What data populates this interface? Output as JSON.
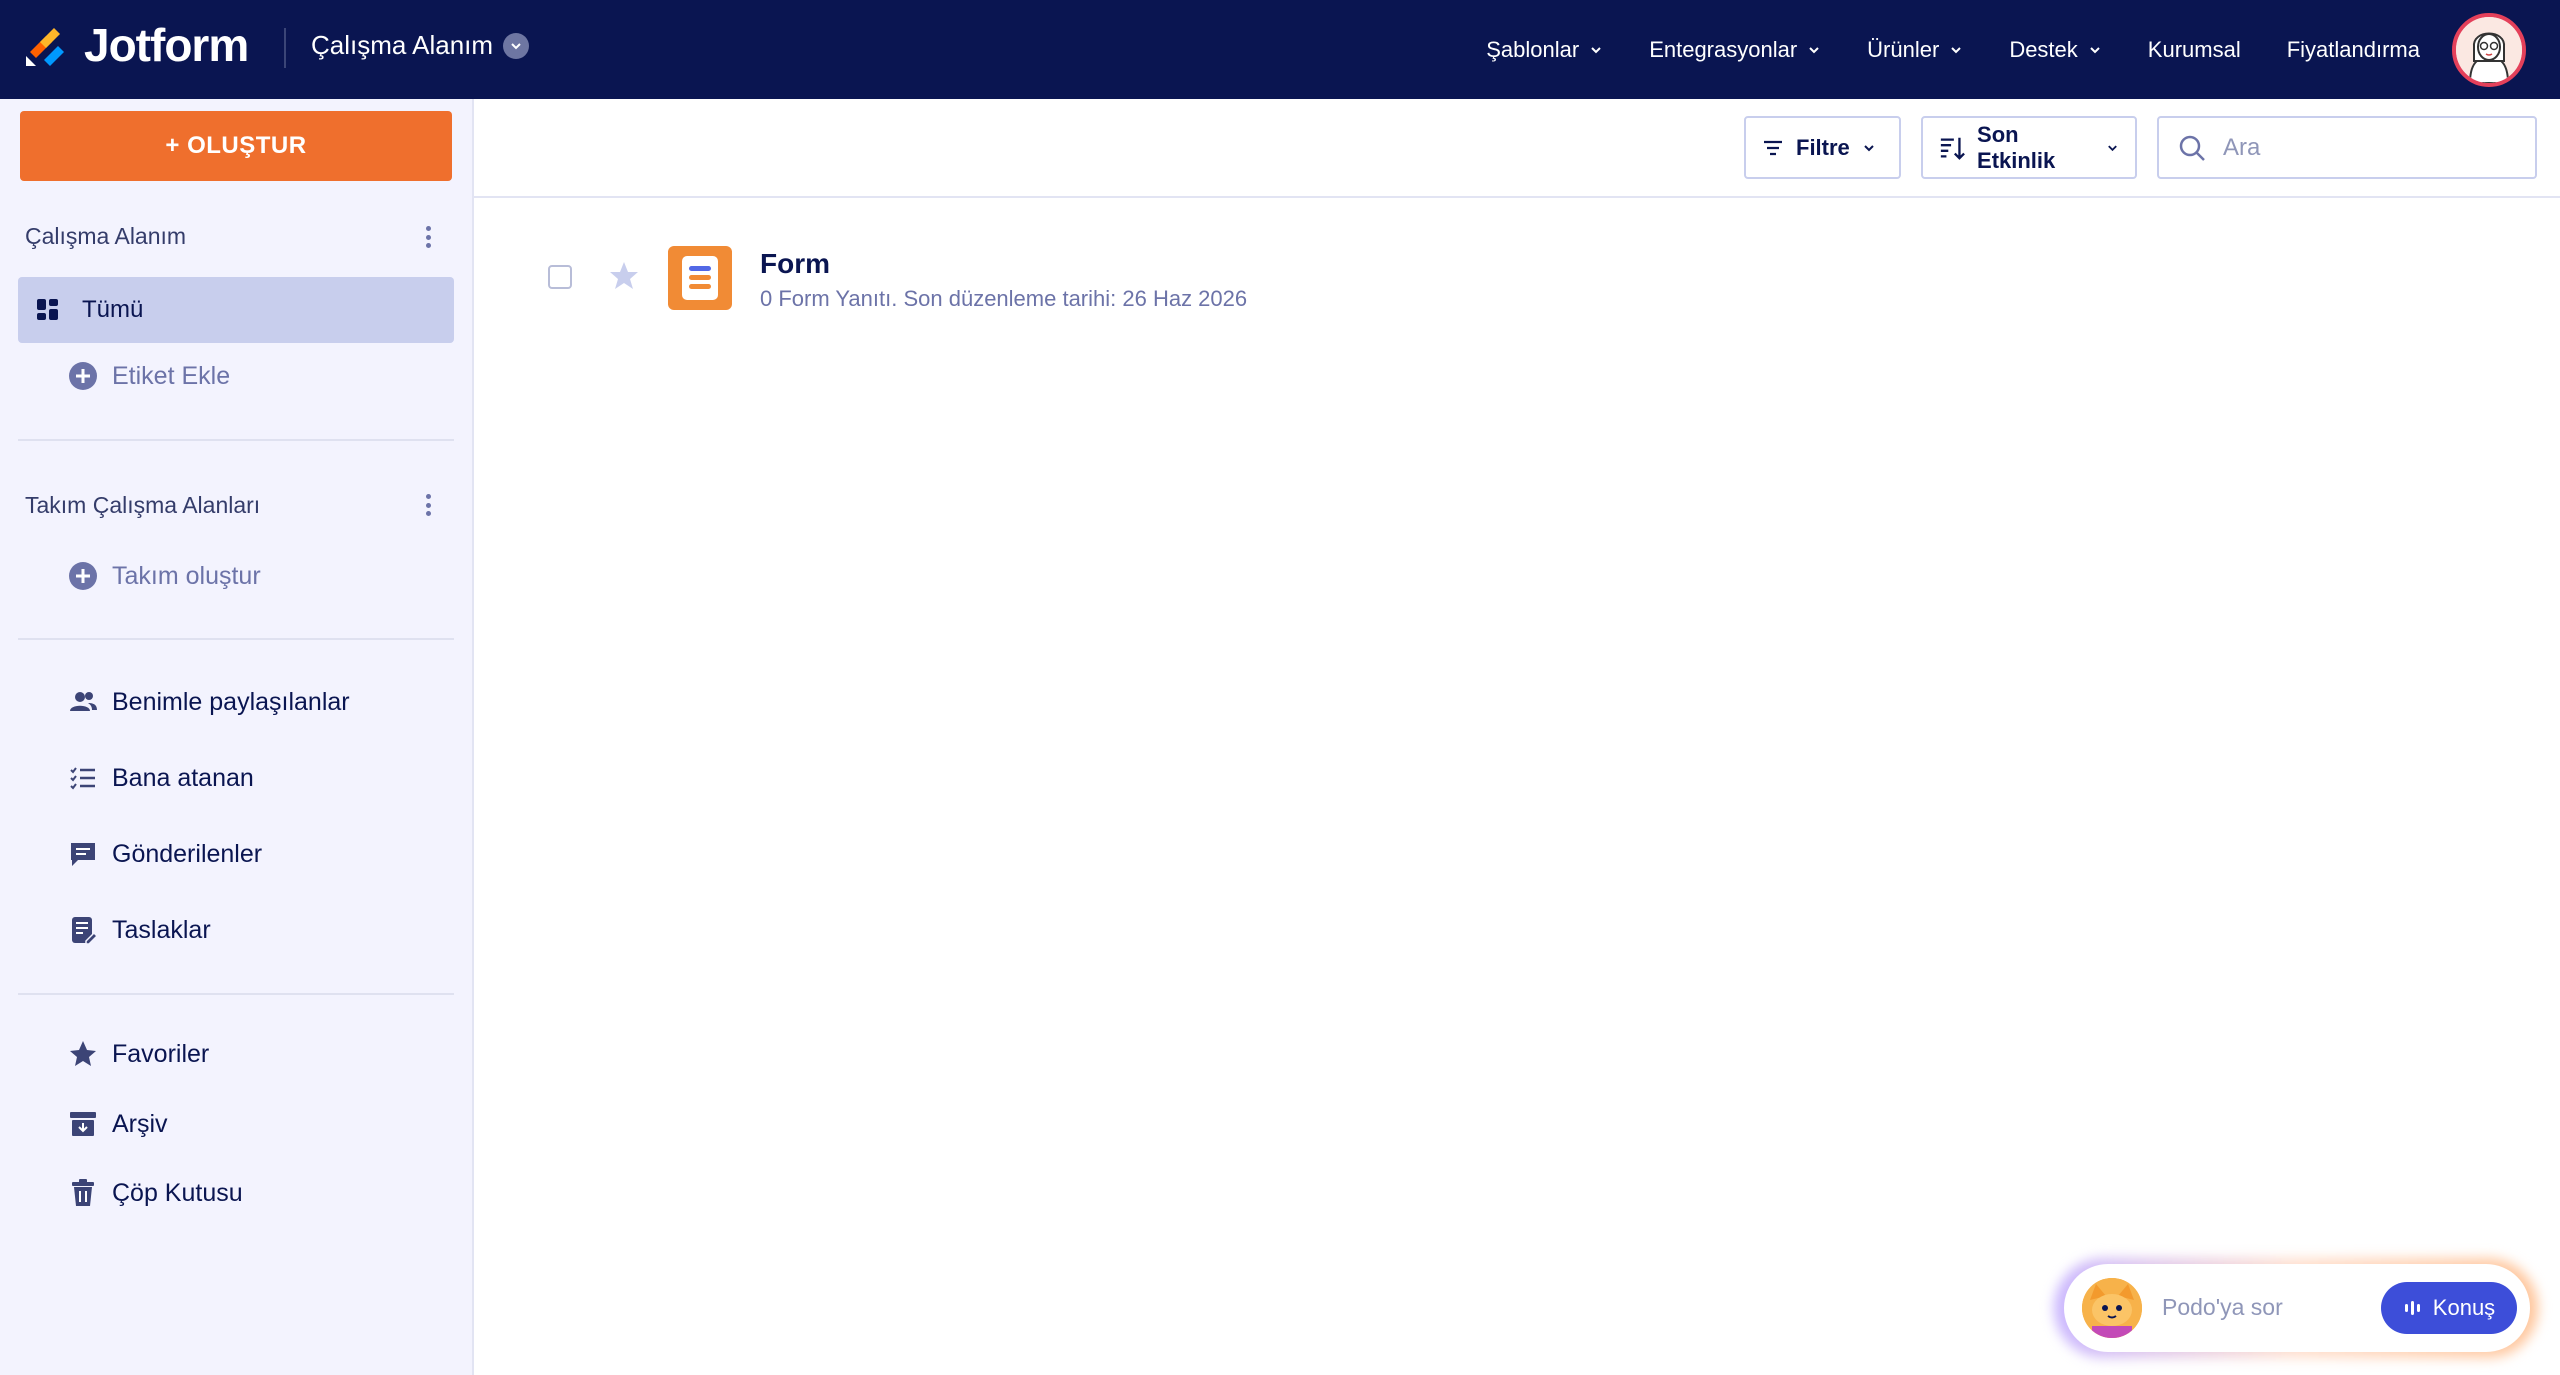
{
  "app": {
    "brand": "Jotform",
    "workspace_title": "Çalışma Alanım"
  },
  "nav": {
    "items": [
      {
        "label": "Şablonlar",
        "dropdown": true
      },
      {
        "label": "Entegrasyonlar",
        "dropdown": true
      },
      {
        "label": "Ürünler",
        "dropdown": true
      },
      {
        "label": "Destek",
        "dropdown": true
      },
      {
        "label": "Kurumsal",
        "dropdown": false
      },
      {
        "label": "Fiyatlandırma",
        "dropdown": false
      }
    ]
  },
  "sidebar": {
    "create_label": "+ OLUŞTUR",
    "my_workspace": {
      "title": "Çalışma Alanım",
      "all_label": "Tümü",
      "add_tag_label": "Etiket Ekle"
    },
    "team_workspaces": {
      "title": "Takım Çalışma Alanları",
      "create_team_label": "Takım oluştur"
    },
    "shared": {
      "shared_with_me": "Benimle paylaşılanlar",
      "assigned_to_me": "Bana atanan",
      "sent": "Gönderilenler",
      "drafts": "Taslaklar"
    },
    "other": {
      "favorites": "Favoriler",
      "archive": "Arşiv",
      "trash": "Çöp Kutusu"
    }
  },
  "toolbar": {
    "filter_label": "Filtre",
    "sort_label": "Son Etkinlik",
    "search_placeholder": "Ara"
  },
  "forms": [
    {
      "title": "Form",
      "meta": "0 Form Yanıtı. Son düzenleme tarihi: 26 Haz 2026"
    }
  ],
  "podo": {
    "placeholder": "Podo'ya sor",
    "talk_label": "Konuş"
  },
  "colors": {
    "navy": "#0a1551",
    "accent_orange": "#ef6f2d",
    "active_item": "#c8ceed",
    "podo_button": "#3d4ed9"
  }
}
